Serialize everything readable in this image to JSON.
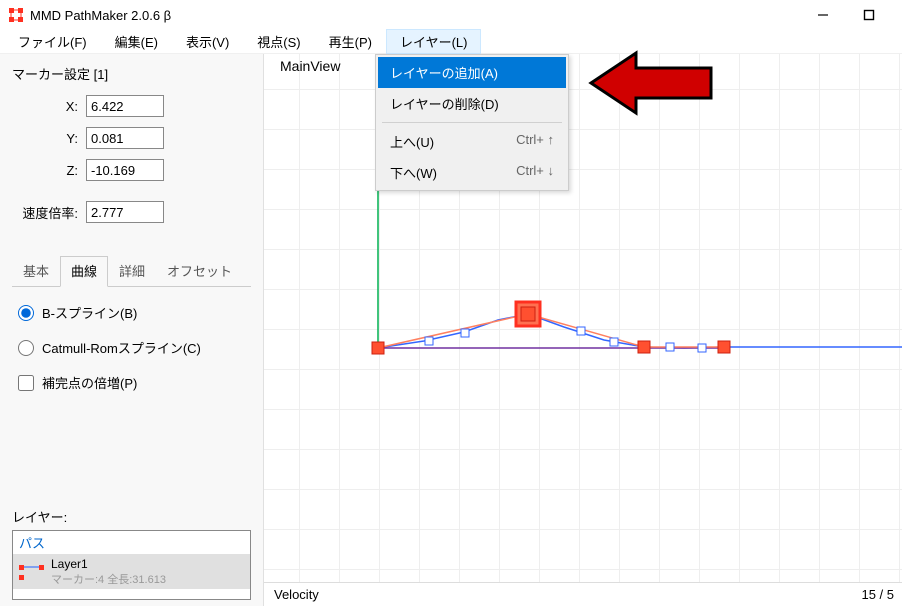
{
  "app": {
    "title": "MMD PathMaker 2.0.6 β"
  },
  "menubar": {
    "items": [
      "ファイル(F)",
      "編集(E)",
      "表示(V)",
      "視点(S)",
      "再生(P)",
      "レイヤー(L)"
    ],
    "open_index": 5
  },
  "dropdown": {
    "items": [
      {
        "label": "レイヤーの追加(A)",
        "shortcut": "",
        "highlighted": true
      },
      {
        "label": "レイヤーの削除(D)",
        "shortcut": "",
        "highlighted": false
      },
      {
        "sep": true
      },
      {
        "label": "上へ(U)",
        "shortcut": "Ctrl+ ↑",
        "highlighted": false
      },
      {
        "label": "下へ(W)",
        "shortcut": "Ctrl+ ↓",
        "highlighted": false
      }
    ]
  },
  "marker": {
    "title": "マーカー設定 [1]",
    "x_label": "X:",
    "x_value": "6.422",
    "y_label": "Y:",
    "y_value": "0.081",
    "z_label": "Z:",
    "z_value": "-10.169",
    "speed_label": "速度倍率:",
    "speed_value": "2.777"
  },
  "tabs": {
    "items": [
      "基本",
      "曲線",
      "詳細",
      "オフセット"
    ],
    "active": 1
  },
  "curve": {
    "radio_bspline": "B-スプライン(B)",
    "radio_catmull": "Catmull-Romスプライン(C)",
    "check_multiply": "補完点の倍増(P)",
    "selected": "bspline"
  },
  "layer": {
    "section_label": "レイヤー:",
    "header": "パス",
    "item_name": "Layer1",
    "item_info": "マーカー:4 全長:31.613"
  },
  "mainview": {
    "label": "MainView",
    "velocity_label": "Velocity",
    "frame_counter": "15 / 5"
  },
  "chart_data": {
    "type": "line",
    "description": "Top-down path view: 4 red markers connected by blue B-spline curve over a grid. A green vertical origin line at x=0.",
    "markers": [
      {
        "x": 0.0,
        "y": 0.0,
        "selected": false
      },
      {
        "x": 6.4,
        "y": 0.08,
        "selected": true
      },
      {
        "x": 16.0,
        "y": 0.0,
        "selected": false
      },
      {
        "x": 22.0,
        "y": 0.0,
        "selected": false
      }
    ],
    "origin_line": {
      "x": 0,
      "color": "#00b050"
    },
    "curve_color": "#2060ff",
    "marker_color": "#ff4030"
  }
}
